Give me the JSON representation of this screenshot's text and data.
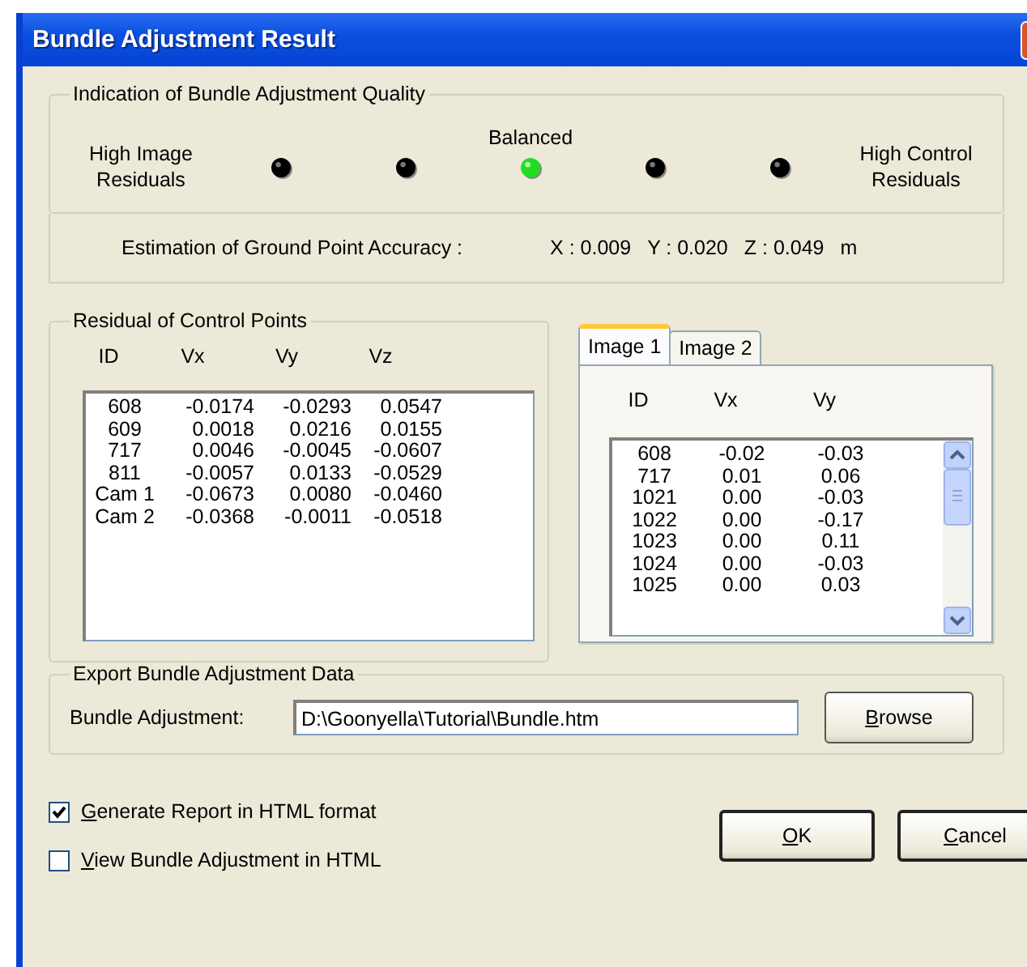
{
  "window": {
    "title": "Bundle Adjustment Result"
  },
  "quality": {
    "title": "Indication of Bundle Adjustment Quality",
    "left_label": "High Image Residuals",
    "right_label": "High Control Residuals",
    "lamps": [
      {
        "on": false
      },
      {
        "on": false
      },
      {
        "on": true,
        "label": "Balanced"
      },
      {
        "on": false
      },
      {
        "on": false
      }
    ]
  },
  "accuracy": {
    "label": "Estimation of Ground Point Accuracy :",
    "x": "X : 0.009",
    "y": "Y : 0.020",
    "z": "Z : 0.049",
    "unit": "m"
  },
  "control_points": {
    "title": "Residual of Control Points",
    "columns": [
      "ID",
      "Vx",
      "Vy",
      "Vz"
    ],
    "rows": [
      [
        "608",
        "-0.0174",
        "-0.0293",
        "0.0547"
      ],
      [
        "609",
        "0.0018",
        "0.0216",
        "0.0155"
      ],
      [
        "717",
        "0.0046",
        "-0.0045",
        "-0.0607"
      ],
      [
        "811",
        "-0.0057",
        "0.0133",
        "-0.0529"
      ],
      [
        "Cam 1",
        "-0.0673",
        "0.0080",
        "-0.0460"
      ],
      [
        "Cam 2",
        "-0.0368",
        "-0.0011",
        "-0.0518"
      ]
    ]
  },
  "image_tabs": {
    "tabs": [
      {
        "label": "Image 1",
        "selected": true
      },
      {
        "label": "Image 2",
        "selected": false
      }
    ],
    "columns": [
      "ID",
      "Vx",
      "Vy"
    ],
    "rows": [
      [
        "608",
        "-0.02",
        "-0.03"
      ],
      [
        "717",
        "0.01",
        "0.06"
      ],
      [
        "1021",
        "0.00",
        "-0.03"
      ],
      [
        "1022",
        "0.00",
        "-0.17"
      ],
      [
        "1023",
        "0.00",
        "0.11"
      ],
      [
        "1024",
        "0.00",
        "-0.03"
      ],
      [
        "1025",
        "0.00",
        "0.03"
      ]
    ]
  },
  "export": {
    "title": "Export Bundle Adjustment Data",
    "label": "Bundle Adjustment:",
    "value": "D:\\Goonyella\\Tutorial\\Bundle.htm",
    "browse": "Browse"
  },
  "options": [
    {
      "label": "Generate Report in HTML format",
      "checked": true
    },
    {
      "label": "View Bundle Adjustment in HTML",
      "checked": false
    }
  ],
  "buttons": [
    "OK",
    "Cancel"
  ]
}
